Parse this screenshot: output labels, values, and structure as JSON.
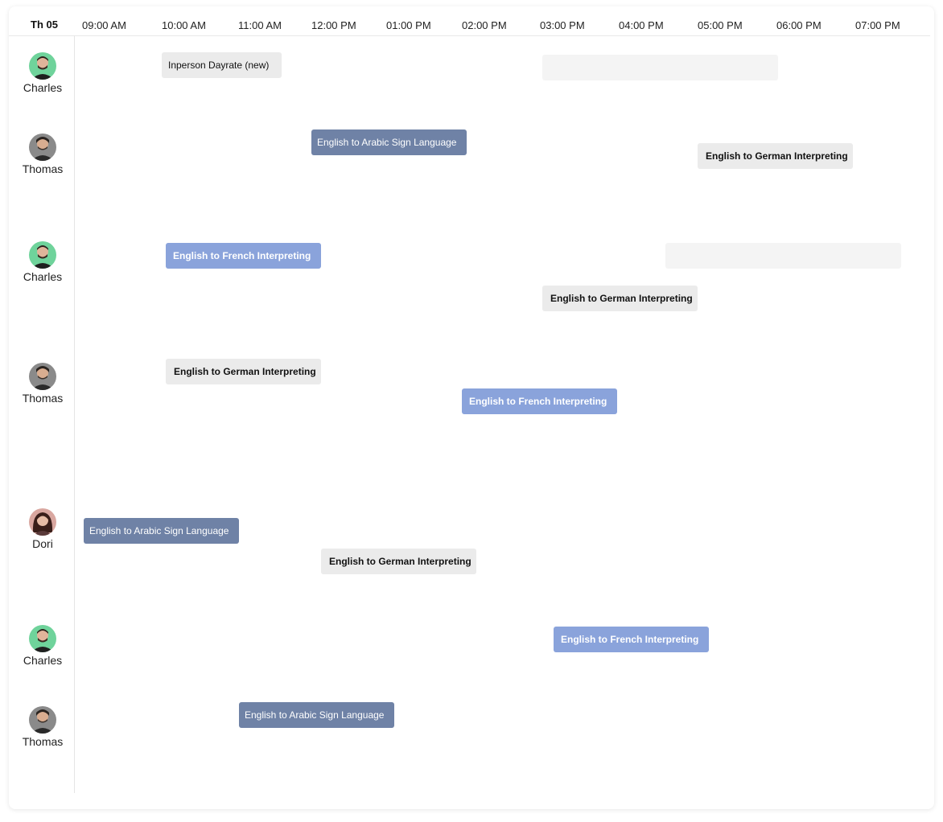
{
  "header": {
    "day": "Th 05",
    "times": [
      "09:00 AM",
      "10:00 AM",
      "11:00 AM",
      "12:00 PM",
      "01:00 PM",
      "02:00 PM",
      "03:00 PM",
      "04:00 PM",
      "05:00 PM",
      "06:00 PM",
      "07:00 PM"
    ]
  },
  "rows": [
    {
      "name": "Charles",
      "avatar_bg": "#6fd39b"
    },
    {
      "name": "Thomas",
      "avatar_bg": "#8a8a8a"
    },
    {
      "name": "Charles",
      "avatar_bg": "#6fd39b"
    },
    {
      "name": "Thomas",
      "avatar_bg": "#8a8a8a"
    },
    {
      "name": "Dori",
      "avatar_bg": "#d9a7a0"
    },
    {
      "name": "Charles",
      "avatar_bg": "#6fd39b"
    },
    {
      "name": "Thomas",
      "avatar_bg": "#8a8a8a"
    }
  ],
  "events": {
    "e1": "Inperson Dayrate (new)",
    "e2": "English to Arabic Sign Language",
    "e3": "English to German Interpreting",
    "e4": "English to French Interpreting",
    "e5": "English to German Interpreting",
    "e6": "English to German Interpreting",
    "e7": "English to French Interpreting",
    "e8": "English to Arabic Sign Language",
    "e9": "English to German Interpreting",
    "e10": "English to French Interpreting",
    "e11": "English to Arabic Sign Language"
  },
  "colors": {
    "slate": "#6f82a6",
    "blue": "#8aa3db",
    "gray": "#ebebeb",
    "empty": "#f4f4f4"
  }
}
